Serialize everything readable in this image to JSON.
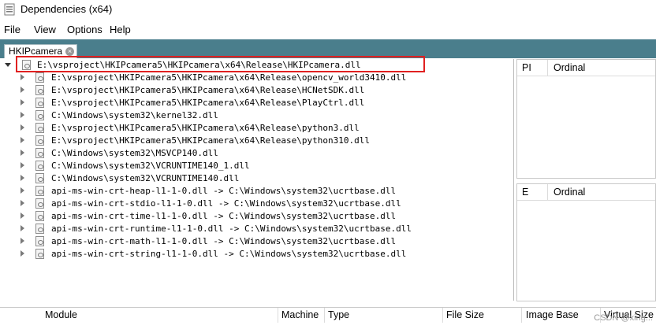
{
  "window": {
    "title": "Dependencies (x64)",
    "icon": "app-window-icon"
  },
  "menu": [
    "File",
    "View",
    "Options",
    "Help"
  ],
  "tabs": [
    {
      "label": "HKIPcamera",
      "close_icon": "close-circle-icon"
    }
  ],
  "tree": {
    "root": "E:\\vsproject\\HKIPcamera5\\HKIPcamera\\x64\\Release\\HKIPcamera.dll",
    "children": [
      "E:\\vsproject\\HKIPcamera5\\HKIPcamera\\x64\\Release\\opencv_world3410.dll",
      "E:\\vsproject\\HKIPcamera5\\HKIPcamera\\x64\\Release\\HCNetSDK.dll",
      "E:\\vsproject\\HKIPcamera5\\HKIPcamera\\x64\\Release\\PlayCtrl.dll",
      "C:\\Windows\\system32\\kernel32.dll",
      "E:\\vsproject\\HKIPcamera5\\HKIPcamera\\x64\\Release\\python3.dll",
      "E:\\vsproject\\HKIPcamera5\\HKIPcamera\\x64\\Release\\python310.dll",
      "C:\\Windows\\system32\\MSVCP140.dll",
      "C:\\Windows\\system32\\VCRUNTIME140_1.dll",
      "C:\\Windows\\system32\\VCRUNTIME140.dll",
      "api-ms-win-crt-heap-l1-1-0.dll -> C:\\Windows\\system32\\ucrtbase.dll",
      "api-ms-win-crt-stdio-l1-1-0.dll -> C:\\Windows\\system32\\ucrtbase.dll",
      "api-ms-win-crt-time-l1-1-0.dll -> C:\\Windows\\system32\\ucrtbase.dll",
      "api-ms-win-crt-runtime-l1-1-0.dll -> C:\\Windows\\system32\\ucrtbase.dll",
      "api-ms-win-crt-math-l1-1-0.dll -> C:\\Windows\\system32\\ucrtbase.dll",
      "api-ms-win-crt-string-l1-1-0.dll -> C:\\Windows\\system32\\ucrtbase.dll"
    ]
  },
  "imports_panel": {
    "col1": "PI",
    "col2": "Ordinal"
  },
  "exports_panel": {
    "col1": "E",
    "col2": "Ordinal"
  },
  "modules_table": {
    "columns": [
      "Module",
      "Machine",
      "Type",
      "File Size",
      "Image Base",
      "Virtual Size"
    ]
  },
  "watermark": "CSDN @xing...",
  "colors": {
    "tab_strip": "#4a7e8c",
    "highlight_border": "#e02020"
  }
}
